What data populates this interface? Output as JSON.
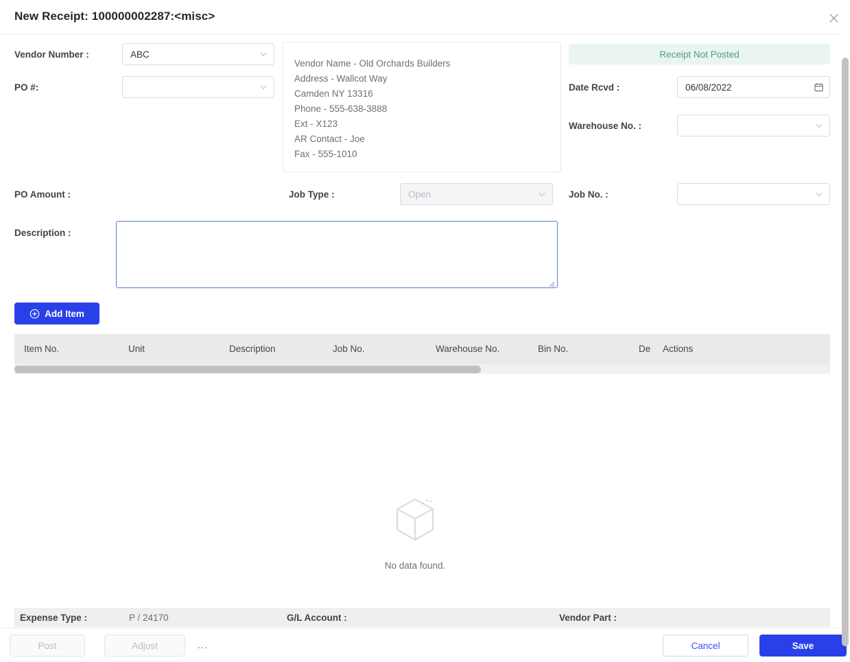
{
  "header": {
    "title": "New Receipt: 100000002287:<misc>",
    "close_icon": "close-icon"
  },
  "form": {
    "vendor_number_label": "Vendor Number :",
    "vendor_number_value": "ABC",
    "po_number_label": "PO #:",
    "po_number_value": "",
    "po_amount_label": "PO Amount :",
    "po_amount_value": "",
    "job_type_label": "Job Type :",
    "job_type_value": "Open",
    "description_label": "Description :",
    "description_value": "",
    "date_rcvd_label": "Date Rcvd :",
    "date_rcvd_value": "06/08/2022",
    "warehouse_no_label": "Warehouse No. :",
    "warehouse_no_value": "",
    "job_no_label": "Job No. :",
    "job_no_value": ""
  },
  "status_badge": {
    "text": "Receipt Not Posted",
    "color": "#4a9c87",
    "background": "#eaf5f2"
  },
  "vendor_info": [
    "Vendor Name - Old Orchards Builders",
    "Address - Wallcot Way",
    "Camden NY 13316",
    "Phone - 555-638-3888",
    "Ext - X123",
    "AR Contact - Joe",
    "Fax - 555-1010"
  ],
  "toolbar": {
    "add_item_label": "Add Item",
    "add_item_icon": "plus-circle-icon",
    "accent": "#2940e8"
  },
  "items_table": {
    "columns": [
      "Item No.",
      "Unit",
      "Description",
      "Job No.",
      "Warehouse No.",
      "Bin No.",
      "De",
      "Actions"
    ],
    "rows": [],
    "empty_text": "No data found.",
    "empty_icon": "empty-box-icon"
  },
  "sub_footer": {
    "expense_type_label": "Expense Type :",
    "expense_type_value": "P / 24170",
    "gl_account_label": "G/L Account :",
    "gl_account_value": "",
    "vendor_part_label": "Vendor Part :",
    "vendor_part_value": ""
  },
  "footer": {
    "post_label": "Post",
    "adjust_label": "Adjust",
    "more_label": "...",
    "cancel_label": "Cancel",
    "save_label": "Save"
  }
}
